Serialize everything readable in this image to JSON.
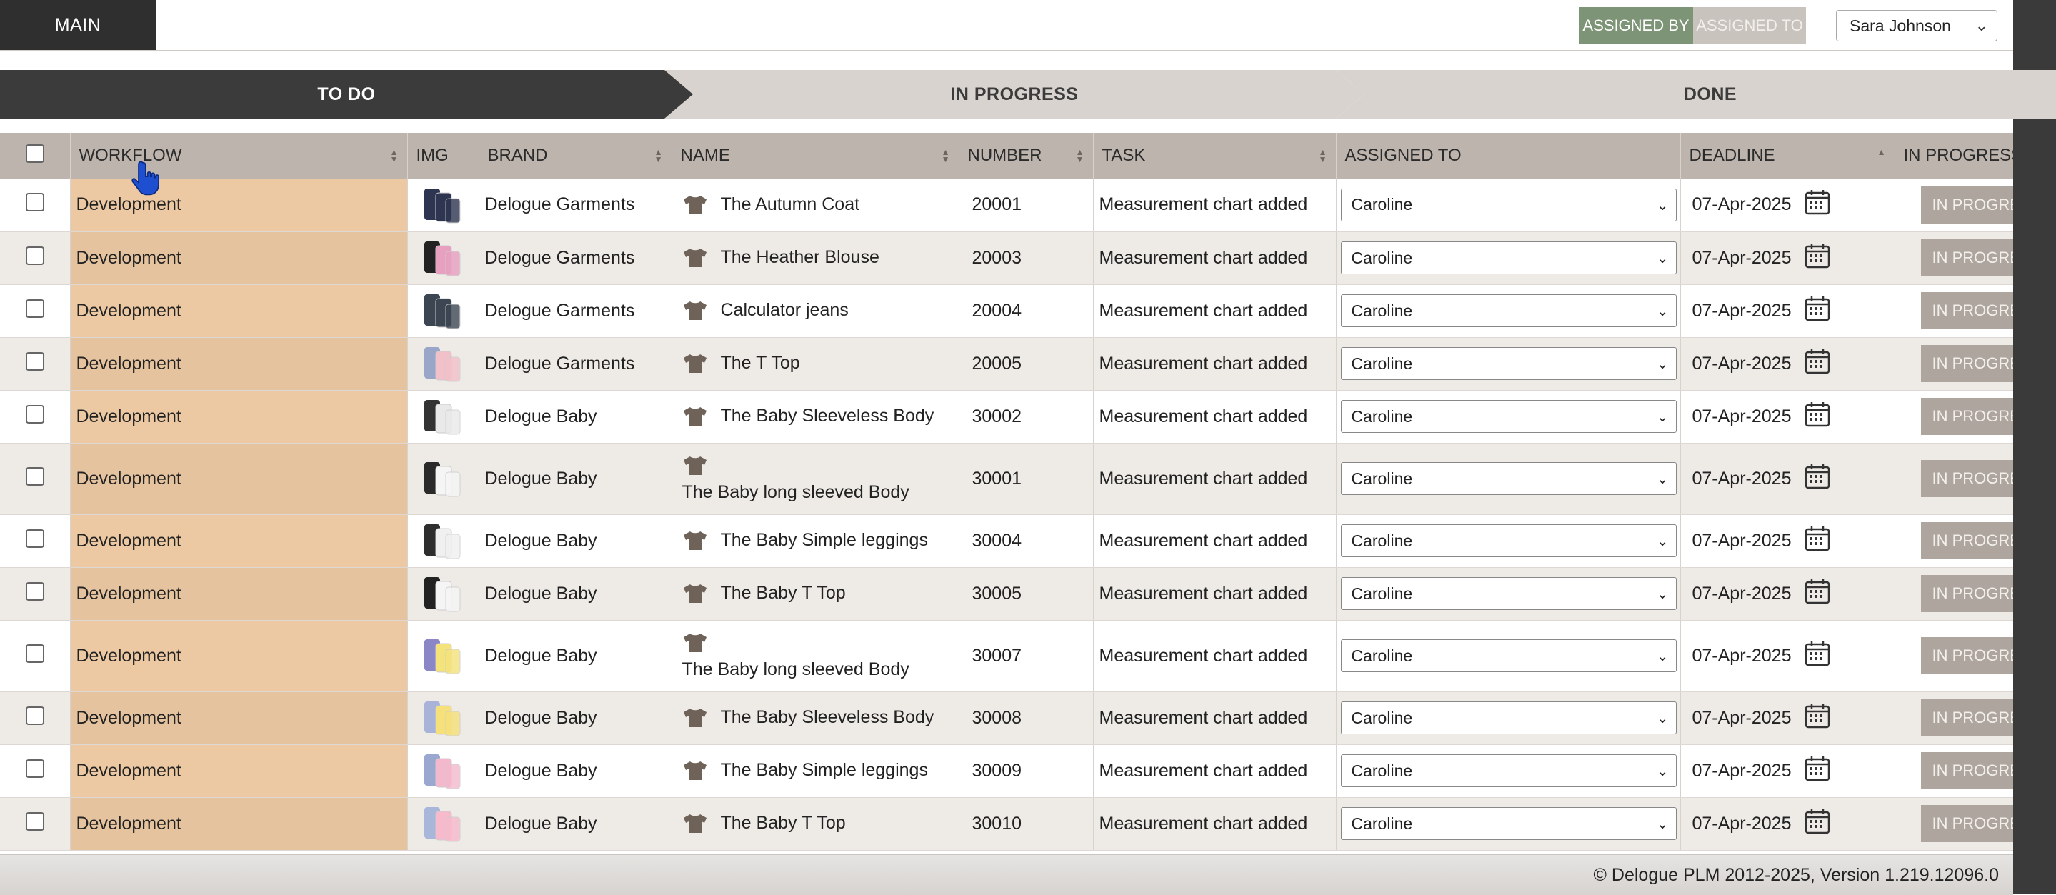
{
  "topbar": {
    "main_tab": "MAIN",
    "assigned_by": "ASSIGNED BY",
    "assigned_to": "ASSIGNED TO",
    "user_select": "Sara Johnson"
  },
  "stages": {
    "todo": "TO DO",
    "in_progress": "IN PROGRESS",
    "done": "DONE"
  },
  "columns": [
    "WORKFLOW",
    "IMG",
    "BRAND",
    "NAME",
    "NUMBER",
    "TASK",
    "ASSIGNED TO",
    "DEADLINE",
    "IN PROGRESS"
  ],
  "rows": [
    {
      "workflow": "Development",
      "brand": "Delogue Garments",
      "name": "The Autumn Coat",
      "number": "20001",
      "task": "Measurement chart added",
      "assigned": "Caroline",
      "deadline": "07-Apr-2025",
      "status": "IN PROGRESS"
    },
    {
      "workflow": "Development",
      "brand": "Delogue Garments",
      "name": "The Heather Blouse",
      "number": "20003",
      "task": "Measurement chart added",
      "assigned": "Caroline",
      "deadline": "07-Apr-2025",
      "status": "IN PROGRESS"
    },
    {
      "workflow": "Development",
      "brand": "Delogue Garments",
      "name": "Calculator jeans",
      "number": "20004",
      "task": "Measurement chart added",
      "assigned": "Caroline",
      "deadline": "07-Apr-2025",
      "status": "IN PROGRESS"
    },
    {
      "workflow": "Development",
      "brand": "Delogue Garments",
      "name": "The T Top",
      "number": "20005",
      "task": "Measurement chart added",
      "assigned": "Caroline",
      "deadline": "07-Apr-2025",
      "status": "IN PROGRESS"
    },
    {
      "workflow": "Development",
      "brand": "Delogue Baby",
      "name": "The Baby Sleeveless Body",
      "number": "30002",
      "task": "Measurement chart added",
      "assigned": "Caroline",
      "deadline": "07-Apr-2025",
      "status": "IN PROGRESS"
    },
    {
      "workflow": "Development",
      "brand": "Delogue Baby",
      "name": "The Baby long sleeved Body",
      "number": "30001",
      "task": "Measurement chart added",
      "assigned": "Caroline",
      "deadline": "07-Apr-2025",
      "status": "IN PROGRESS"
    },
    {
      "workflow": "Development",
      "brand": "Delogue Baby",
      "name": "The Baby Simple leggings",
      "number": "30004",
      "task": "Measurement chart added",
      "assigned": "Caroline",
      "deadline": "07-Apr-2025",
      "status": "IN PROGRESS"
    },
    {
      "workflow": "Development",
      "brand": "Delogue Baby",
      "name": "The Baby T Top",
      "number": "30005",
      "task": "Measurement chart added",
      "assigned": "Caroline",
      "deadline": "07-Apr-2025",
      "status": "IN PROGRESS"
    },
    {
      "workflow": "Development",
      "brand": "Delogue Baby",
      "name": "The Baby long sleeved Body",
      "number": "30007",
      "task": "Measurement chart added",
      "assigned": "Caroline",
      "deadline": "07-Apr-2025",
      "status": "IN PROGRESS"
    },
    {
      "workflow": "Development",
      "brand": "Delogue Baby",
      "name": "The Baby Sleeveless Body",
      "number": "30008",
      "task": "Measurement chart added",
      "assigned": "Caroline",
      "deadline": "07-Apr-2025",
      "status": "IN PROGRESS"
    },
    {
      "workflow": "Development",
      "brand": "Delogue Baby",
      "name": "The Baby Simple leggings",
      "number": "30009",
      "task": "Measurement chart added",
      "assigned": "Caroline",
      "deadline": "07-Apr-2025",
      "status": "IN PROGRESS"
    },
    {
      "workflow": "Development",
      "brand": "Delogue Baby",
      "name": "The Baby T Top",
      "number": "30010",
      "task": "Measurement chart added",
      "assigned": "Caroline",
      "deadline": "07-Apr-2025",
      "status": "IN PROGRESS"
    }
  ],
  "footer": "© Delogue PLM 2012-2025, Version 1.219.12096.0",
  "colors": {
    "workflow_cell": "#ecc9a2",
    "assigned_by_active": "#7d9476",
    "header_bg": "#bdb4ad",
    "stage_active": "#3b3b3b"
  }
}
